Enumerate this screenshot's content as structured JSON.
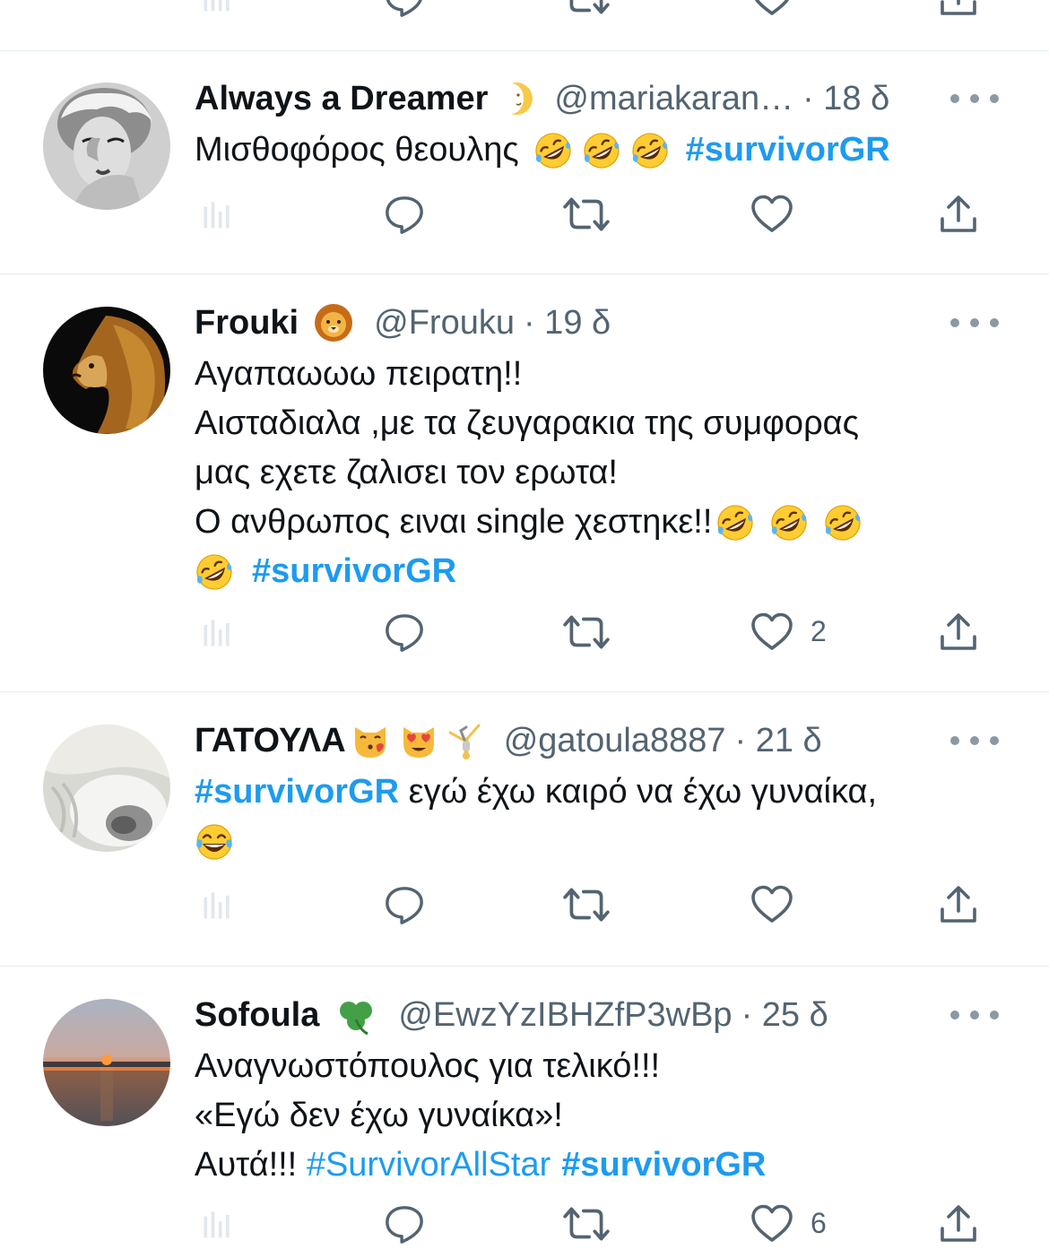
{
  "colors": {
    "link": "#1d9bf0",
    "text": "#0f1419",
    "muted": "#536471",
    "divider": "#e6ecf0"
  },
  "tweets": [
    {
      "name": "Always a Dreamer",
      "badges": [
        "crescent-moon-emoji"
      ],
      "handle": "@mariakaran…",
      "time": "· 18 δ",
      "lines": [
        [
          "Μισθοφόρος θεουλης ",
          "🤣",
          "🤣",
          "🤣",
          "#survivorGR"
        ]
      ],
      "text1": "Μισθοφόρος θεουλης",
      "tag1": "#survivorGR",
      "likes": "",
      "avatar": "portrait-woman-photo"
    },
    {
      "name": "Frouki",
      "badges": [
        "lion-face-emoji"
      ],
      "handle": "@Frouku",
      "time": "· 19 δ",
      "line1": "Αγαπαωωω πειρατη!!",
      "line2": "Αισταδιαλα ,με τα ζευγαρακια της συμφορας",
      "line3": "μας εχετε ζαλισει τον ερωτα!",
      "line4": "Ο ανθρωπος ειναι single χεστηκε!!",
      "tag1": "#survivorGR",
      "likes": "2",
      "avatar": "lion-photo"
    },
    {
      "name": "ΓΑΤΟΥΛΑ",
      "badges": [
        "kissing-cat-emoji",
        "heart-eyes-cat-emoji",
        "cartwheel-emoji"
      ],
      "handle": "@gatoula8887",
      "time": "· 21 δ",
      "tag1": "#survivorGR",
      "line1": " εγώ έχω καιρό να έχω γυναίκα,",
      "likes": "",
      "avatar": "sleeping-cat-photo"
    },
    {
      "name": "Sofoula",
      "badges": [
        "shamrock-emoji"
      ],
      "handle": "@EwzYzIBHZfP3wBp",
      "time": "· 25 δ",
      "line1": "Αναγνωστόπουλος για τελικό!!!",
      "line2": "«Εγώ δεν έχω γυναίκα»!",
      "line3": "Αυτά!!! ",
      "tag1": "#SurvivorAllStar",
      "tag2": "#survivorGR",
      "likes": "6",
      "avatar": "sunset-sea-photo"
    }
  ]
}
